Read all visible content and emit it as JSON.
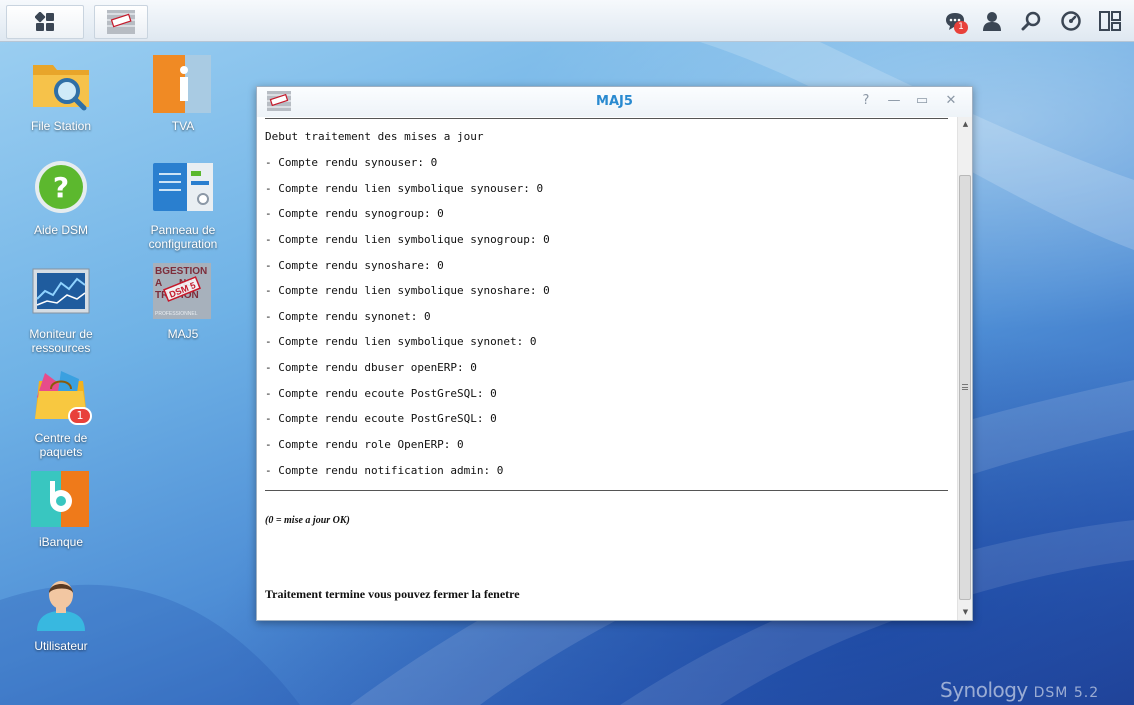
{
  "taskbar": {
    "main_menu_icon": "grid-icon",
    "open_app_icon": "maj5-app-icon",
    "notifications_count": "1",
    "right_icons": [
      "notifications-icon",
      "user-icon",
      "search-icon",
      "dashboard-icon",
      "widgets-icon"
    ]
  },
  "desktop": {
    "icons": [
      {
        "label": "File Station"
      },
      {
        "label": "TVA"
      },
      {
        "label": "Aide DSM"
      },
      {
        "label": "Panneau de configuration"
      },
      {
        "label": "Moniteur de ressources"
      },
      {
        "label": "MAJ5"
      },
      {
        "label": "Centre de paquets",
        "badge": "1"
      },
      {
        "label": "iBanque"
      },
      {
        "label": "Utilisateur"
      }
    ],
    "maj5_icon_text": [
      "BGESTION",
      "A",
      "NS",
      "TRATION",
      "DSM 5",
      "PROFESSIONNEL"
    ]
  },
  "window": {
    "title": "MAJ5",
    "controls": [
      "?",
      "—",
      "▭",
      "✕"
    ],
    "log_lines": [
      "Debut traitement des mises a jour",
      "- Compte rendu synouser: 0",
      "- Compte rendu lien symbolique synouser: 0",
      "- Compte rendu synogroup: 0",
      "- Compte rendu lien symbolique synogroup: 0",
      "- Compte rendu synoshare: 0",
      "- Compte rendu lien symbolique synoshare: 0",
      "- Compte rendu synonet: 0",
      "- Compte rendu lien symbolique synonet: 0",
      "- Compte rendu dbuser openERP: 0",
      "- Compte rendu ecoute PostGreSQL: 0",
      "- Compte rendu ecoute PostGreSQL: 0",
      "- Compte rendu role OpenERP: 0",
      "- Compte rendu notification admin: 0"
    ],
    "note": "(0 = mise a jour OK)",
    "final_message": "Traitement termine vous pouvez fermer la fenetre"
  },
  "branding": {
    "name": "Synology",
    "version": "DSM 5.2"
  },
  "colors": {
    "accent": "#2a8ad0",
    "badge": "#e8413b"
  }
}
